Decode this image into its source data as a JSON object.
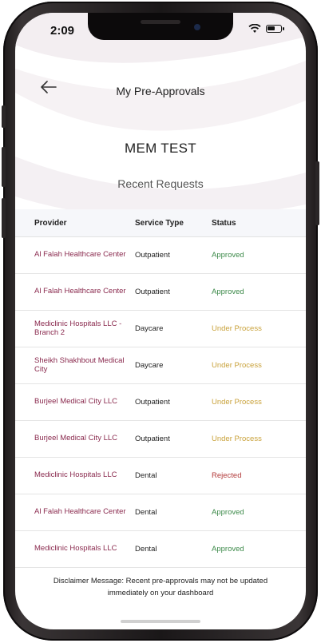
{
  "status_bar": {
    "time": "2:09"
  },
  "header": {
    "title": "My Pre-Approvals"
  },
  "member": {
    "name": "MEM TEST"
  },
  "section": {
    "title": "Recent Requests"
  },
  "table": {
    "columns": [
      "Provider",
      "Service Type",
      "Status"
    ],
    "rows": [
      {
        "provider": "Al Falah Healthcare Center",
        "service": "Outpatient",
        "status": "Approved",
        "kind": "approved"
      },
      {
        "provider": "Al Falah Healthcare Center",
        "service": "Outpatient",
        "status": "Approved",
        "kind": "approved"
      },
      {
        "provider": "Mediclinic Hospitals LLC - Branch 2",
        "service": "Daycare",
        "status": "Under Process",
        "kind": "process"
      },
      {
        "provider": "Sheikh Shakhbout Medical City",
        "service": "Daycare",
        "status": "Under Process",
        "kind": "process"
      },
      {
        "provider": "Burjeel Medical City LLC",
        "service": "Outpatient",
        "status": "Under Process",
        "kind": "process"
      },
      {
        "provider": "Burjeel Medical City LLC",
        "service": "Outpatient",
        "status": "Under Process",
        "kind": "process"
      },
      {
        "provider": "Mediclinic Hospitals LLC",
        "service": "Dental",
        "status": "Rejected",
        "kind": "rejected"
      },
      {
        "provider": "Al Falah Healthcare Center",
        "service": "Dental",
        "status": "Approved",
        "kind": "approved"
      },
      {
        "provider": "Mediclinic Hospitals LLC",
        "service": "Dental",
        "status": "Approved",
        "kind": "approved"
      }
    ]
  },
  "disclaimer": {
    "text": "Disclaimer Message: Recent pre-approvals may not be updated immediately on your dashboard"
  },
  "colors": {
    "provider": "#8a2a4e",
    "approved": "#3d8a4a",
    "process": "#c9a23b",
    "rejected": "#b23a3a"
  },
  "icons": {
    "back": "arrow-left-icon",
    "wifi": "wifi-icon",
    "battery": "battery-icon"
  }
}
